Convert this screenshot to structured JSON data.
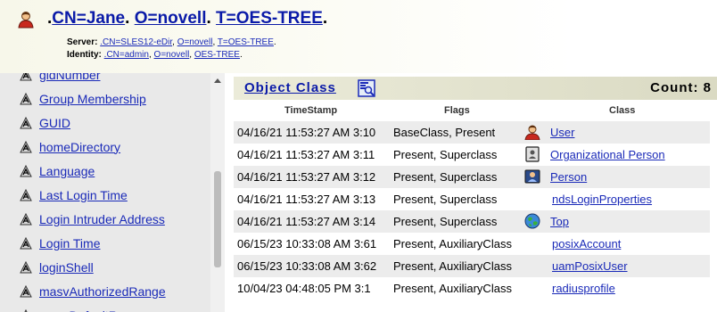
{
  "header": {
    "title_prefix": ".",
    "cn": "CN=Jane",
    "o": "O=novell",
    "t": "T=OES-TREE",
    "title_suffix": ".",
    "sep": ". ",
    "server_label": "Server:",
    "server_cn": ".CN=SLES12-eDir",
    "server_o": "O=novell",
    "server_t": "T=OES-TREE",
    "identity_label": "Identity:",
    "identity_cn": ".CN=admin",
    "identity_o": "O=novell",
    "identity_t": "OES-TREE"
  },
  "attributes": [
    "gidNumber",
    "Group Membership",
    "GUID",
    "homeDirectory",
    "Language",
    "Last Login Time",
    "Login Intruder Address",
    "Login Time",
    "loginShell",
    "masvAuthorizedRange",
    "masvDefaultRange"
  ],
  "object_class": {
    "title": "Object Class",
    "count": "Count: 8",
    "columns": {
      "timestamp": "TimeStamp",
      "flags": "Flags",
      "class": "Class"
    },
    "rows": [
      {
        "timestamp": "04/16/21 11:53:27 AM 3:10",
        "flags": "BaseClass, Present",
        "icon": "user-icon",
        "class": "User"
      },
      {
        "timestamp": "04/16/21 11:53:27 AM 3:11",
        "flags": "Present, Superclass",
        "icon": "org-person-icon",
        "class": "Organizational Person"
      },
      {
        "timestamp": "04/16/21 11:53:27 AM 3:12",
        "flags": "Present, Superclass",
        "icon": "person-icon",
        "class": "Person"
      },
      {
        "timestamp": "04/16/21 11:53:27 AM 3:13",
        "flags": "Present, Superclass",
        "icon": "",
        "class": "ndsLoginProperties"
      },
      {
        "timestamp": "04/16/21 11:53:27 AM 3:14",
        "flags": "Present, Superclass",
        "icon": "globe-icon",
        "class": "Top"
      },
      {
        "timestamp": "06/15/23 10:33:08 AM 3:61",
        "flags": "Present, AuxiliaryClass",
        "icon": "",
        "class": "posixAccount"
      },
      {
        "timestamp": "06/15/23 10:33:08 AM 3:62",
        "flags": "Present, AuxiliaryClass",
        "icon": "",
        "class": "uamPosixUser"
      },
      {
        "timestamp": "10/04/23 04:48:05 PM 3:1",
        "flags": "Present, AuxiliaryClass",
        "icon": "",
        "class": "radiusprofile"
      }
    ]
  }
}
